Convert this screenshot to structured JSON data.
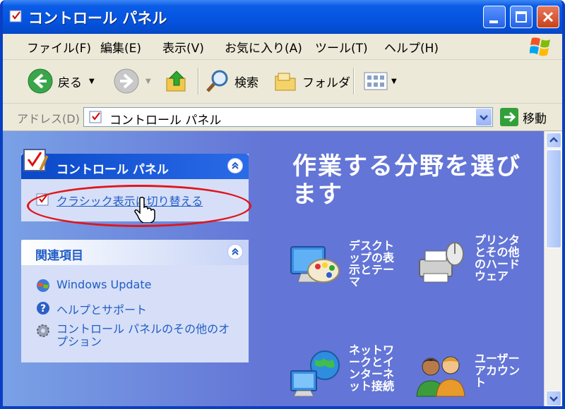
{
  "window": {
    "title": "コントロール パネル"
  },
  "menubar": {
    "items": [
      "ファイル(F)",
      "編集(E)",
      "表示(V)",
      "お気に入り(A)",
      "ツール(T)",
      "ヘルプ(H)"
    ]
  },
  "toolbar": {
    "back_label": "戻る",
    "search_label": "検索",
    "folders_label": "フォルダ"
  },
  "address": {
    "label": "アドレス(D)",
    "value": "コントロール パネル",
    "go_label": "移動"
  },
  "sidebar": {
    "panel1_title": "コントロール パネル",
    "switch_link": "クラシック表示に切り替える",
    "panel2_title": "関連項目",
    "related": [
      "Windows Update",
      "ヘルプとサポート",
      "コントロール パネルのその他のオプション"
    ]
  },
  "main": {
    "heading": "作業する分野を選びます",
    "categories": [
      {
        "label": "デスクトップの表示とテーマ",
        "icon": "desktop-theme-icon"
      },
      {
        "label": "プリンタとその他のハードウェア",
        "icon": "printer-icon"
      },
      {
        "label": "ネットワークとインターネット接続",
        "icon": "network-icon"
      },
      {
        "label": "ユーザー アカウント",
        "icon": "users-icon"
      }
    ]
  },
  "colors": {
    "titlebar": "#0554e0",
    "pane": "#6375d6",
    "link": "#215dc6",
    "highlight": "#e0161c"
  }
}
